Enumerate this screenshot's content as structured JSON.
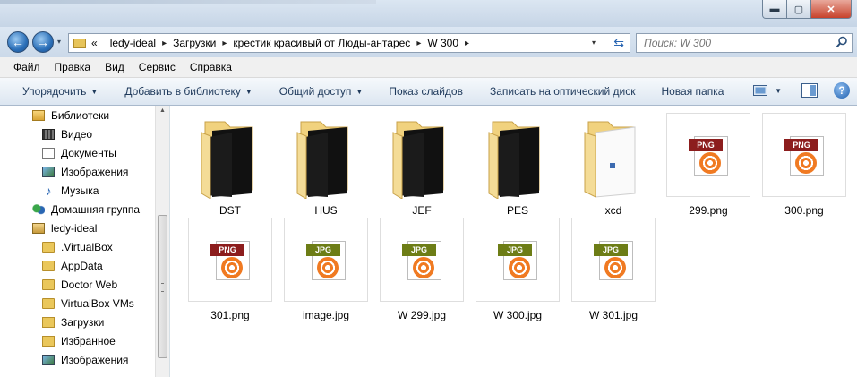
{
  "window": {
    "min_glyph": "▬",
    "max_glyph": "▢",
    "close_glyph": "✕"
  },
  "nav_buttons": {
    "back_glyph": "←",
    "forward_glyph": "→",
    "dropdown_glyph": "▾"
  },
  "address": {
    "overflow": "«",
    "crumbs": [
      "ledy-ideal",
      "Загрузки",
      "крестик красивый от Люды-антарес",
      "W 300"
    ],
    "separator": "▸"
  },
  "search": {
    "placeholder": "Поиск: W 300"
  },
  "menu": [
    "Файл",
    "Правка",
    "Вид",
    "Сервис",
    "Справка"
  ],
  "toolbar": {
    "organize": "Упорядочить",
    "add_library": "Добавить в библиотеку",
    "share": "Общий доступ",
    "slideshow": "Показ слайдов",
    "burn": "Записать на оптический диск",
    "new_folder": "Новая папка",
    "help": "?"
  },
  "nav_tree": [
    {
      "label": "Библиотеки",
      "icon": "library-icon",
      "level": 1
    },
    {
      "label": "Видео",
      "icon": "video-icon",
      "level": 2
    },
    {
      "label": "Документы",
      "icon": "documents-icon",
      "level": 2
    },
    {
      "label": "Изображения",
      "icon": "pictures-icon",
      "level": 2
    },
    {
      "label": "Музыка",
      "icon": "music-icon",
      "level": 2
    },
    {
      "label": "Домашняя группа",
      "icon": "homegroup-icon",
      "level": 1
    },
    {
      "label": "ledy-ideal",
      "icon": "user-folder-icon",
      "level": 1
    },
    {
      "label": ".VirtualBox",
      "icon": "folder-icon",
      "level": 2
    },
    {
      "label": "AppData",
      "icon": "folder-icon",
      "level": 2
    },
    {
      "label": "Doctor Web",
      "icon": "folder-icon",
      "level": 2
    },
    {
      "label": "VirtualBox VMs",
      "icon": "folder-icon",
      "level": 2
    },
    {
      "label": "Загрузки",
      "icon": "downloads-icon",
      "level": 2
    },
    {
      "label": "Избранное",
      "icon": "favorites-icon",
      "level": 2
    },
    {
      "label": "Изображения",
      "icon": "pictures-icon",
      "level": 2
    }
  ],
  "files": [
    {
      "name": "DST",
      "kind": "folder"
    },
    {
      "name": "HUS",
      "kind": "folder"
    },
    {
      "name": "JEF",
      "kind": "folder"
    },
    {
      "name": "PES",
      "kind": "folder"
    },
    {
      "name": "xcd",
      "kind": "folder-doc"
    },
    {
      "name": "299.png",
      "kind": "image",
      "badge": "PNG"
    },
    {
      "name": "300.png",
      "kind": "image",
      "badge": "PNG"
    },
    {
      "name": "301.png",
      "kind": "image",
      "badge": "PNG"
    },
    {
      "name": "image.jpg",
      "kind": "image",
      "badge": "JPG"
    },
    {
      "name": "W 299.jpg",
      "kind": "image",
      "badge": "JPG"
    },
    {
      "name": "W 300.jpg",
      "kind": "image",
      "badge": "JPG"
    },
    {
      "name": "W 301.jpg",
      "kind": "image",
      "badge": "JPG"
    }
  ],
  "colors": {
    "accent": "#2a66b3",
    "folder": "#eac75b",
    "png_badge": "#8c1d1d",
    "jpg_badge": "#6d7d16"
  }
}
